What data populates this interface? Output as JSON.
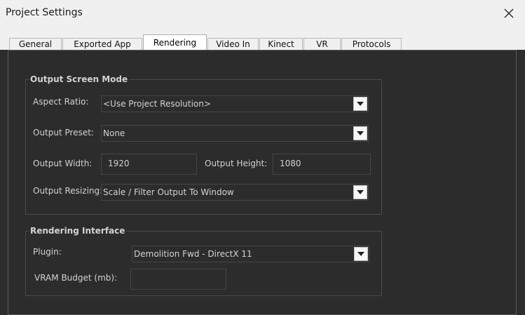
{
  "window": {
    "title": "Project Settings",
    "close_icon": "close-icon"
  },
  "tabs": [
    {
      "label": "General",
      "active": false
    },
    {
      "label": "Exported App",
      "active": false
    },
    {
      "label": "Rendering",
      "active": true
    },
    {
      "label": "Video In",
      "active": false
    },
    {
      "label": "Kinect",
      "active": false
    },
    {
      "label": "VR",
      "active": false
    },
    {
      "label": "Protocols",
      "active": false
    }
  ],
  "output_screen_mode": {
    "title": "Output Screen Mode",
    "aspect_ratio": {
      "label": "Aspect Ratio:",
      "value": "<Use Project Resolution>"
    },
    "output_preset": {
      "label": "Output Preset:",
      "value": "None"
    },
    "output_width": {
      "label": "Output Width:",
      "value": "1920"
    },
    "output_height": {
      "label": "Output Height:",
      "value": "1080"
    },
    "output_resizing": {
      "label": "Output Resizing:",
      "value": "Scale / Filter Output To Window"
    }
  },
  "rendering_interface": {
    "title": "Rendering Interface",
    "plugin": {
      "label": "Plugin:",
      "value": "Demolition Fwd - DirectX 11"
    },
    "vram_budget": {
      "label": "VRAM Budget (mb):",
      "value": ""
    }
  },
  "colors": {
    "background": "#2d2d2d",
    "titlebar": "#f0f0f0",
    "text": "#d2d2d2"
  }
}
